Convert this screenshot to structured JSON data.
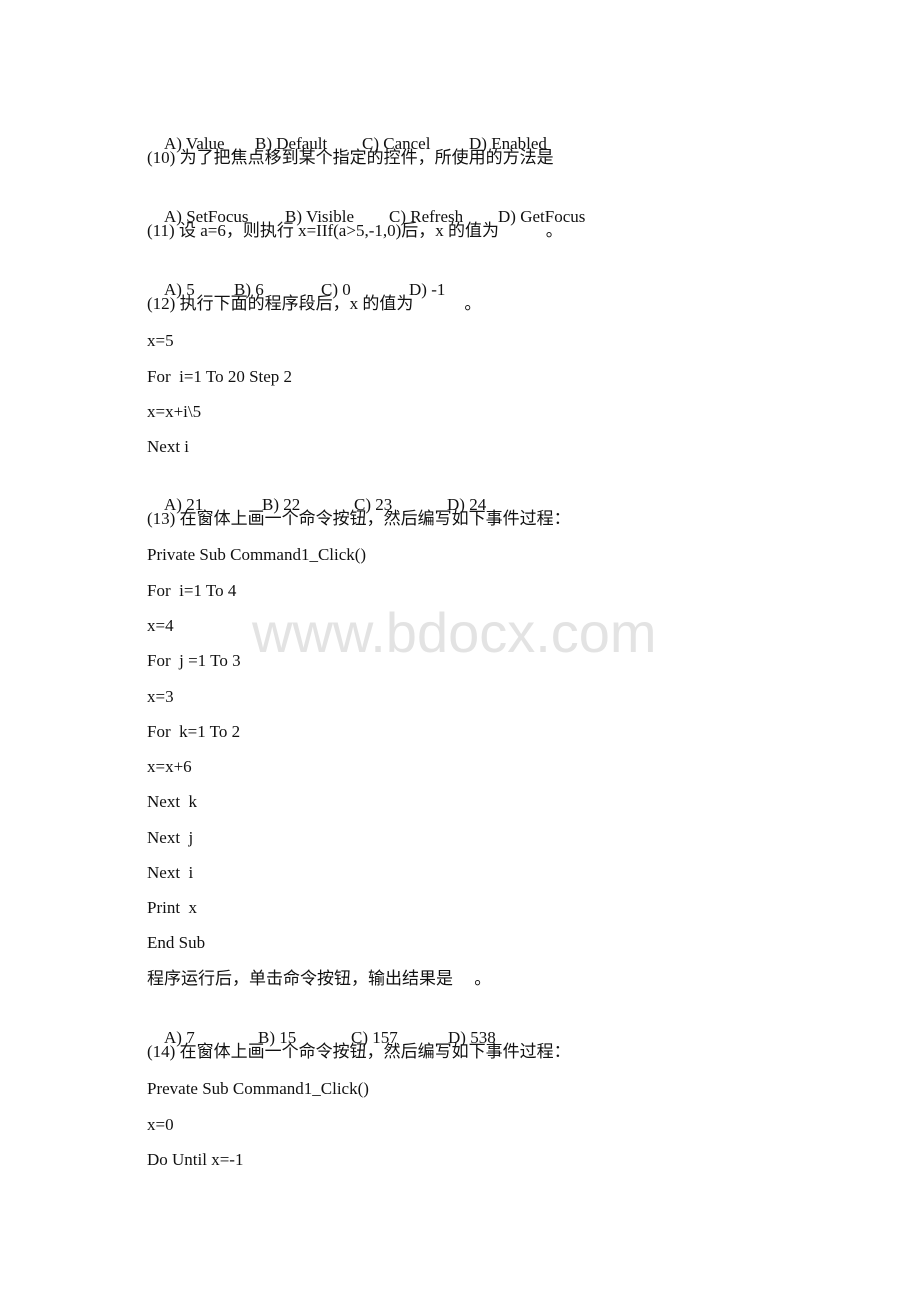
{
  "watermark": "www.bdocx.com",
  "lines": [
    {
      "kind": "options",
      "options": [
        "A) Value",
        "B) Default",
        "C) Cancel",
        "D) Enabled"
      ]
    },
    {
      "kind": "text",
      "text": "(10) 为了把焦点移到某个指定的控件，所使用的方法是"
    },
    {
      "kind": "options",
      "options": [
        "A) SetFocus",
        "B) Visible",
        "C) Refresh",
        "D) GetFocus"
      ]
    },
    {
      "kind": "text",
      "text": "(11) 设 a=6，则执行 x=IIf(a>5,-1,0)后，x 的值为           。"
    },
    {
      "kind": "options",
      "options": [
        "A) 5",
        "B) 6",
        "C) 0",
        "D) -1"
      ]
    },
    {
      "kind": "text",
      "text": "(12) 执行下面的程序段后，x 的值为            。"
    },
    {
      "kind": "text",
      "text": "x=5"
    },
    {
      "kind": "text",
      "text": "For  i=1 To 20 Step 2"
    },
    {
      "kind": "text",
      "text": "x=x+i\\5"
    },
    {
      "kind": "text",
      "text": "Next i"
    },
    {
      "kind": "options",
      "options": [
        "A) 21",
        "B) 22",
        "C) 23",
        "D) 24"
      ]
    },
    {
      "kind": "text",
      "text": "(13) 在窗体上画一个命令按钮，然后编写如下事件过程："
    },
    {
      "kind": "text",
      "text": "Private Sub Command1_Click()"
    },
    {
      "kind": "text",
      "text": "For  i=1 To 4"
    },
    {
      "kind": "text",
      "text": "x=4"
    },
    {
      "kind": "text",
      "text": "For  j =1 To 3"
    },
    {
      "kind": "text",
      "text": "x=3"
    },
    {
      "kind": "text",
      "text": "For  k=1 To 2"
    },
    {
      "kind": "text",
      "text": "x=x+6"
    },
    {
      "kind": "text",
      "text": "Next  k"
    },
    {
      "kind": "text",
      "text": "Next  j"
    },
    {
      "kind": "text",
      "text": "Next  i"
    },
    {
      "kind": "text",
      "text": "Print  x"
    },
    {
      "kind": "text",
      "text": "End Sub"
    },
    {
      "kind": "text",
      "text": "程序运行后，单击命令按钮，输出结果是     。"
    },
    {
      "kind": "options",
      "options": [
        "A) 7",
        "B) 15",
        "C) 157",
        "D) 538"
      ]
    },
    {
      "kind": "text",
      "text": "(14) 在窗体上画一个命令按钮，然后编写如下事件过程："
    },
    {
      "kind": "text",
      "text": "Prevate Sub Command1_Click()"
    },
    {
      "kind": "text",
      "text": "x=0"
    },
    {
      "kind": "text",
      "text": "Do Until x=-1"
    }
  ]
}
